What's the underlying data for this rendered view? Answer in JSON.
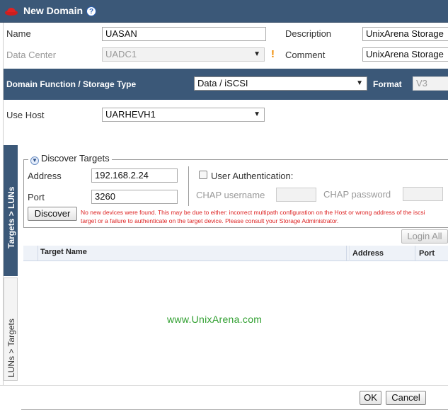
{
  "window": {
    "title": "New Domain",
    "help_glyph": "?"
  },
  "form": {
    "name_label": "Name",
    "name_value": "UASAN",
    "description_label": "Description",
    "description_value": "UnixArena Storage",
    "datacenter_label": "Data Center",
    "datacenter_value": "UADC1",
    "warning_glyph": "!",
    "comment_label": "Comment",
    "comment_value": "UnixArena Storage",
    "domain_function_label": "Domain Function / Storage Type",
    "domain_function_value": "Data / iSCSI",
    "format_label": "Format",
    "format_value": "V3",
    "use_host_label": "Use Host",
    "use_host_value": "UARHEVH1"
  },
  "side_tabs": {
    "active": "Targets > LUNs",
    "inactive": "LUNs > Targets"
  },
  "discover": {
    "legend": "Discover Targets",
    "address_label": "Address",
    "address_value": "192.168.2.24",
    "port_label": "Port",
    "port_value": "3260",
    "user_auth_label": "User Authentication:",
    "chap_username_label": "CHAP username",
    "chap_password_label": "CHAP password",
    "discover_button": "Discover",
    "error_message": "No new devices were found. This may be due to either: incorrect multipath configuration on the Host or wrong address of the iscsi target or a failure to authenticate on the target device. Please consult your Storage Administrator."
  },
  "targets": {
    "login_all_button": "Login All",
    "columns": [
      "Target Name",
      "Address",
      "Port"
    ]
  },
  "watermark": "www.UnixArena.com",
  "footer": {
    "ok_button": "OK",
    "cancel_button": "Cancel"
  },
  "colors": {
    "header_bg": "#3b5878",
    "error_text": "#dd2222",
    "watermark": "#2e9e2e"
  }
}
